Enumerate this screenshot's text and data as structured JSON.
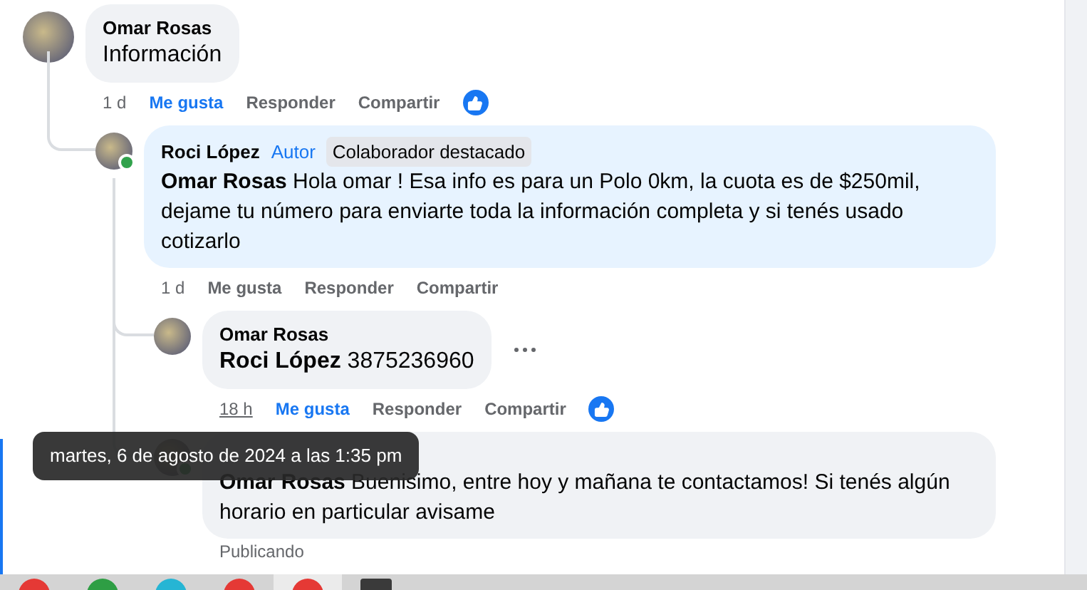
{
  "comments": [
    {
      "author": "Omar Rosas",
      "text": "Información",
      "large": true,
      "online": false,
      "time": "1 d",
      "time_hovered": false,
      "like_label": "Me gusta",
      "liked": true,
      "reply_label": "Responder",
      "share_label": "Compartir",
      "reacted": true,
      "replies": [
        {
          "author": "Roci López",
          "text": "**Omar Rosas** Hola omar ! Esa info es para un Polo 0km, la cuota es de $250mil, dejame tu número para enviarte toda la información completa y si tenés usado cotizarlo",
          "large": false,
          "online": true,
          "tint": true,
          "badges": [
            {
              "kind": "author",
              "label": "Autor"
            },
            {
              "kind": "highlight",
              "label": "Colaborador destacado"
            }
          ],
          "time": "1 d",
          "time_hovered": false,
          "like_label": "Me gusta",
          "liked": false,
          "reply_label": "Responder",
          "share_label": "Compartir",
          "replies": [
            {
              "author": "Omar Rosas",
              "text": "**Roci López** 3875236960",
              "large": true,
              "online": false,
              "time": "18 h",
              "time_hovered": true,
              "like_label": "Me gusta",
              "liked": true,
              "reply_label": "Responder",
              "share_label": "Compartir",
              "reacted": true,
              "more": true
            },
            {
              "text": "**Omar Rosas** Buenisimo, entre hoy y mañana te contactamos! Si tenés algún horario en particular avisame",
              "large": false,
              "online": true,
              "status": "Publicando"
            }
          ]
        }
      ]
    }
  ],
  "tooltip": "martes, 6 de agosto de 2024 a las 1:35 pm"
}
